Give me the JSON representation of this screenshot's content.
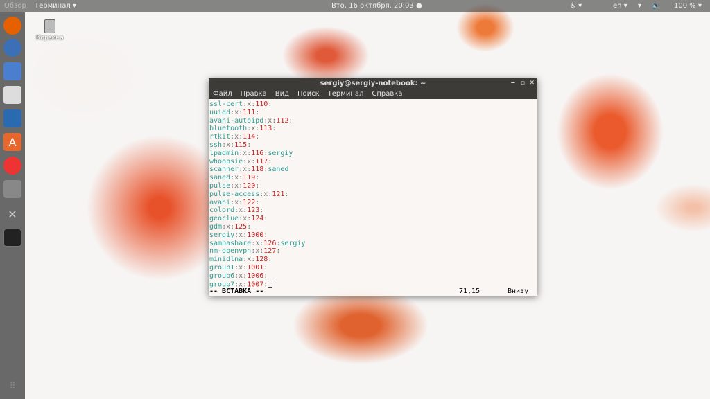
{
  "topbar": {
    "activities": "Обзор",
    "app": "Терминал ▾",
    "clock": "Втo, 16 октября, 20:03 ●",
    "lang": "en ▾",
    "battery": "100 % ▾"
  },
  "desktop": {
    "trash": "Корзина"
  },
  "terminal": {
    "title": "sergiy@sergiy-notebook: ~",
    "menu": [
      "Файл",
      "Правка",
      "Вид",
      "Поиск",
      "Терминал",
      "Справка"
    ],
    "lines": [
      [
        "ssl-cert",
        "110",
        ""
      ],
      [
        "uuidd",
        "111",
        ""
      ],
      [
        "avahi-autoipd",
        "112",
        ""
      ],
      [
        "bluetooth",
        "113",
        ""
      ],
      [
        "rtkit",
        "114",
        ""
      ],
      [
        "ssh",
        "115",
        ""
      ],
      [
        "lpadmin",
        "116",
        "sergiy"
      ],
      [
        "whoopsie",
        "117",
        ""
      ],
      [
        "scanner",
        "118",
        "saned"
      ],
      [
        "saned",
        "119",
        ""
      ],
      [
        "pulse",
        "120",
        ""
      ],
      [
        "pulse-access",
        "121",
        ""
      ],
      [
        "avahi",
        "122",
        ""
      ],
      [
        "colord",
        "123",
        ""
      ],
      [
        "geoclue",
        "124",
        ""
      ],
      [
        "gdm",
        "125",
        ""
      ],
      [
        "sergiy",
        "1000",
        ""
      ],
      [
        "sambashare",
        "126",
        "sergiy"
      ],
      [
        "nm-openvpn",
        "127",
        ""
      ],
      [
        "minidlna",
        "128",
        ""
      ],
      [
        "group1",
        "1001",
        ""
      ],
      [
        "group6",
        "1006",
        ""
      ],
      [
        "group7",
        "1007",
        ""
      ]
    ],
    "mode": "-- ВСТАВКА --",
    "position": "71,15",
    "scroll": "Внизу"
  }
}
